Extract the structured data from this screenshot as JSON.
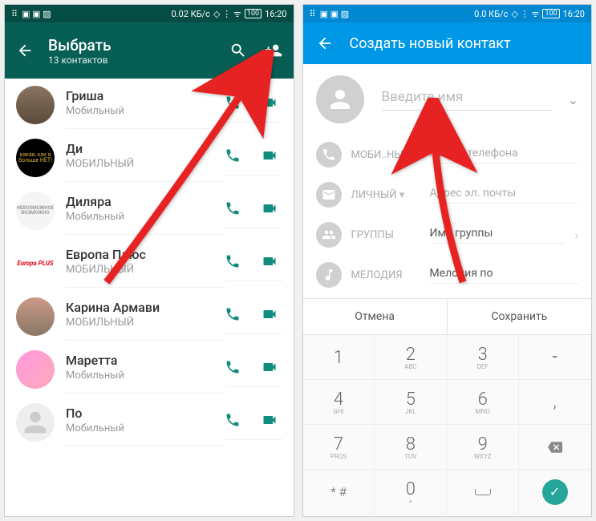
{
  "status": {
    "data": "0.02 КБ/с",
    "data2": "0.0 КБ/с",
    "battery": "100",
    "time": "16:20"
  },
  "wa": {
    "title": "Выбрать",
    "subtitle": "13 контактов",
    "contacts": [
      {
        "name": "Гриша",
        "type": "Мобильный"
      },
      {
        "name": "Ди",
        "type": "МОБИЛЬНЫЙ"
      },
      {
        "name": "Диляра",
        "type": "Мобильный"
      },
      {
        "name": "Европа Плюс",
        "type": "МОБИЛЬНЫЙ"
      },
      {
        "name": "Карина Армави",
        "type": "МОБИЛЬНЫЙ"
      },
      {
        "name": "Маретта",
        "type": "Мобильный"
      },
      {
        "name": "По",
        "type": "Мобильный"
      }
    ],
    "av2": "какая, как я больше НЕТ!",
    "av3": "НЕВОЗМОЖНОЕ ВОЗМОЖНО",
    "av4": "Europa PLUS"
  },
  "blue": {
    "title": "Создать новый контакт",
    "name_placeholder": "Введите имя",
    "rows": [
      {
        "label": "МОБИ..НЫЙ",
        "value": "Номер телефона"
      },
      {
        "label": "ЛИЧНЫЙ",
        "value": "Адрес эл. почты"
      },
      {
        "label": "ГРУППЫ",
        "value": "Имя группы"
      },
      {
        "label": "МЕЛОДИЯ",
        "value": "Мелодия по"
      }
    ],
    "cancel": "Отмена",
    "save": "Сохранить"
  },
  "keypad": {
    "k1": {
      "n": "1",
      "l": ""
    },
    "k2": {
      "n": "2",
      "l": "ABC"
    },
    "k3": {
      "n": "3",
      "l": "DEF"
    },
    "k4": {
      "n": "4",
      "l": "GHI"
    },
    "k5": {
      "n": "5",
      "l": "JKL"
    },
    "k6": {
      "n": "6",
      "l": "MNO"
    },
    "k7": {
      "n": "7",
      "l": "PRQS"
    },
    "k8": {
      "n": "8",
      "l": "TUV"
    },
    "k9": {
      "n": "9",
      "l": "WXYZ"
    },
    "k0": {
      "n": "0",
      "l": "+"
    },
    "kstar": "* #",
    "kdash": "-",
    "kcomma": ",",
    "kcheck": "✓"
  }
}
